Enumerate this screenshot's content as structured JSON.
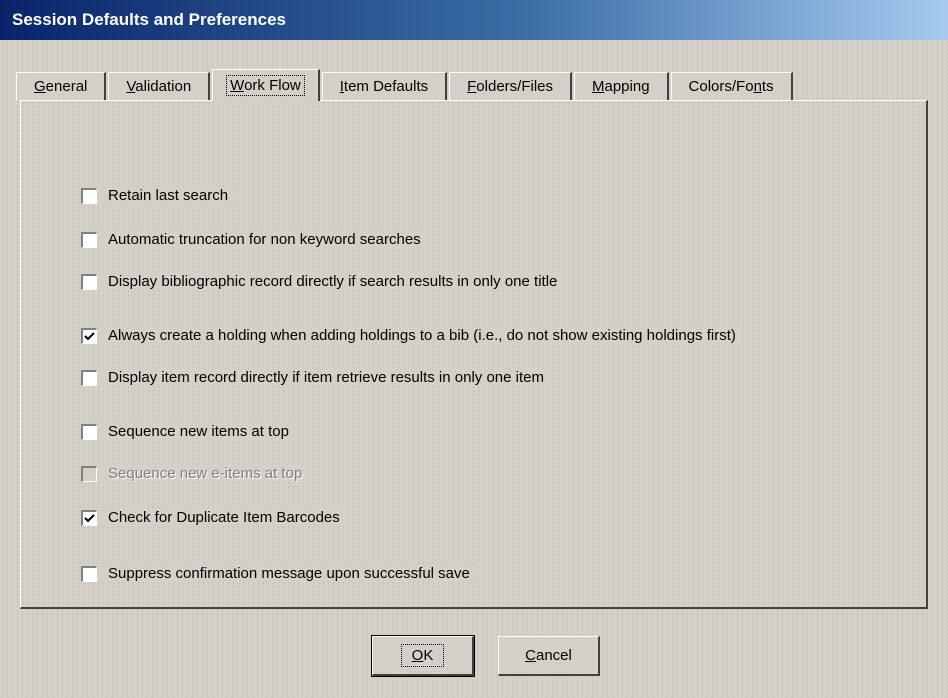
{
  "window": {
    "title": "Session Defaults and Preferences"
  },
  "tabs": [
    {
      "label": "General",
      "accel": "G",
      "rest": "eneral",
      "active": false
    },
    {
      "label": "Validation",
      "accel": "V",
      "rest": "alidation",
      "active": false
    },
    {
      "label": "Work Flow",
      "accel": "W",
      "rest": "ork Flow",
      "active": true
    },
    {
      "label": "Item Defaults",
      "accel": "I",
      "rest": "tem Defaults",
      "active": false
    },
    {
      "label": "Folders/Files",
      "accel": "F",
      "rest": "olders/Files",
      "active": false
    },
    {
      "label": "Mapping",
      "accel": "M",
      "rest": "apping",
      "active": false
    },
    {
      "label": "Colors/Fonts",
      "pre": "Colors/Fo",
      "accel": "n",
      "rest": "ts",
      "active": false
    }
  ],
  "options": [
    {
      "label": "Retain last search",
      "checked": false,
      "enabled": true
    },
    {
      "label": "Automatic truncation for non keyword searches",
      "checked": false,
      "enabled": true
    },
    {
      "label": "Display bibliographic record directly if search results in only one title",
      "checked": false,
      "enabled": true
    },
    {
      "label": "Always create a holding when adding holdings to a bib (i.e., do not show existing holdings first)",
      "checked": true,
      "enabled": true
    },
    {
      "label": "Display item record directly if item retrieve results in only one item",
      "checked": false,
      "enabled": true
    },
    {
      "label": "Sequence new items at top",
      "checked": false,
      "enabled": true
    },
    {
      "label": "Sequence new e-items at top",
      "checked": false,
      "enabled": false
    },
    {
      "label": "Check for Duplicate Item Barcodes",
      "checked": true,
      "enabled": true
    },
    {
      "label": "Suppress confirmation message upon successful save",
      "checked": false,
      "enabled": true
    }
  ],
  "buttons": {
    "ok": {
      "label": "OK",
      "accel": "O",
      "rest": "K"
    },
    "cancel": {
      "label": "Cancel",
      "accel": "C",
      "rest": "ancel"
    }
  }
}
